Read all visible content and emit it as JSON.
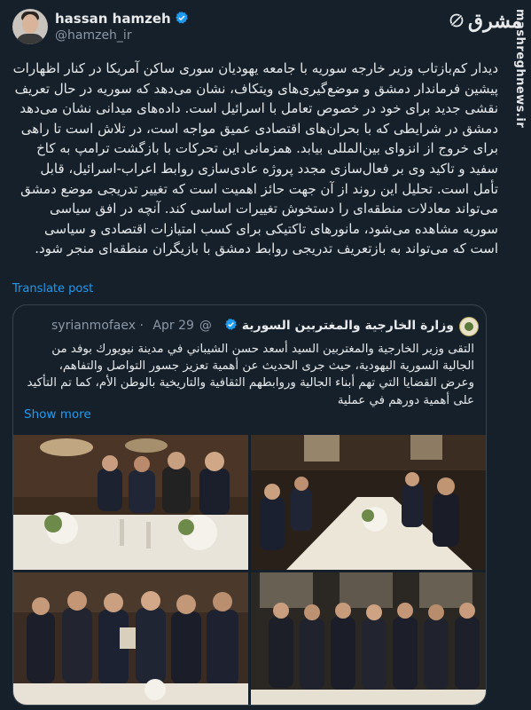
{
  "author": {
    "display_name": "hassan hamzeh",
    "handle": "@hamzeh_ir"
  },
  "brand": {
    "logo_text": "مشرق",
    "watermark": "mashreghnews.ir"
  },
  "tweet": {
    "text": "دیدار کم‌بازتاب وزیر خارجه سوریه با جامعه یهودیان سوری ساکن آمریکا در کنار اظهارات پیشین فرماندار دمشق و موضع‌گیری‌های ویتکاف، نشان می‌دهد که سوریه در حال تعریف نقشی جدید برای خود در خصوص تعامل با اسرائیل است. داده‌های میدانی نشان می‌دهد دمشق در شرایطی که با بحران‌های اقتصادی عمیق مواجه است، در تلاش است تا راهی برای خروج از انزوای بین‌المللی بیابد. همزمانی این تحرکات با بازگشت ترامپ به کاخ سفید و تاکید وی بر فعال‌سازی مجدد پروژه عادی‌سازی روابط اعراب-اسرائیل، قابل تأمل است. تحلیل این روند از آن جهت حائز اهمیت است که تغییر تدریجی موضع دمشق می‌تواند معادلات منطقه‌ای را دستخوش تغییرات اساسی کند. آنچه در افق سیاسی سوریه مشاهده می‌شود، مانورهای تاکتیکی برای کسب امتیازات اقتصادی و سیاسی است که می‌تواند به بازتعریف تدریجی روابط دمشق با بازیگران منطقه‌ای منجر شود.",
    "translate_label": "Translate post"
  },
  "quote": {
    "name": "وزارة الخارجية والمغتربين السورية",
    "handle": "@syrianmofaex",
    "separator": "·",
    "date": "Apr 29",
    "text": "التقى وزير الخارجية والمغتربين السيد أسعد حسن الشيباني في مدينة نيويورك بوفد من الجالية السورية اليهودية، حيث جرى الحديث عن أهمية تعزيز جسور التواصل والتفاهم، وعرض القضايا التي تهم أبناء الجالية وروابطهم الثقافية والتاريخية بالوطن الأم، كما تم التأكيد على أهمية دورهم في عملية",
    "show_more": "Show more"
  },
  "photos": [
    {
      "name": "photo-dinner-table-left"
    },
    {
      "name": "photo-dinner-table-wide"
    },
    {
      "name": "photo-gift-presentation"
    },
    {
      "name": "photo-group-standing"
    }
  ],
  "colors": {
    "background": "#15202b",
    "text": "#e7e9ea",
    "secondary": "#8b98a5",
    "link": "#1d9bf0",
    "verified": "#1d9bf0"
  }
}
